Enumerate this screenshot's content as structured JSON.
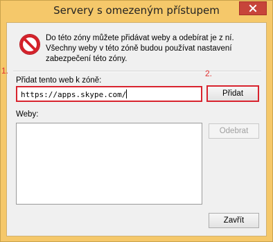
{
  "window": {
    "title": "Servery s omezeným přístupem",
    "close_icon": "close-icon"
  },
  "info": {
    "icon": "prohibited-icon",
    "text": "Do této zóny můžete přidávat weby a odebírat je z ní. Všechny weby v této zóně budou používat nastavení zabezpečení této zóny."
  },
  "add_site": {
    "label": "Přidat tento web k zóně:",
    "value": "https://apps.skype.com/",
    "button_label": "Přidat"
  },
  "annotations": {
    "step1": "1.",
    "step2": "2.",
    "color": "#d8232e"
  },
  "sites": {
    "label": "Weby:",
    "items": [],
    "remove_label": "Odebrat"
  },
  "footer": {
    "close_label": "Zavřít"
  }
}
